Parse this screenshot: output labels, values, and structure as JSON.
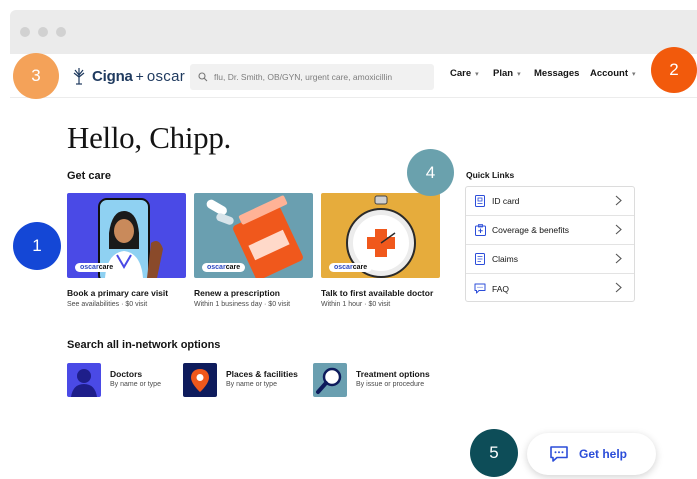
{
  "header": {
    "logo_cigna": "Cigna",
    "logo_plus": "+",
    "logo_oscar": "oscar",
    "search_placeholder": "flu, Dr. Smith, OB/GYN, urgent care, amoxicillin",
    "nav": [
      {
        "label": "Care",
        "has_caret": true
      },
      {
        "label": "Plan",
        "has_caret": true
      },
      {
        "label": "Messages",
        "has_caret": false
      },
      {
        "label": "Account",
        "has_caret": true
      }
    ]
  },
  "greeting": "Hello, Chipp.",
  "get_care": {
    "title": "Get care",
    "badge_text": {
      "oscar": "oscar",
      "care": "care"
    },
    "cards": [
      {
        "title": "Book a primary care visit",
        "subtitle": "See availabilities · $0 visit",
        "bg": "#4a4ae6"
      },
      {
        "title": "Renew a prescription",
        "subtitle": "Within 1 business day · $0 visit",
        "bg": "#6a9fb0"
      },
      {
        "title": "Talk to first available doctor",
        "subtitle": "Within 1 hour · $0 visit",
        "bg": "#e6ac3c"
      }
    ]
  },
  "quick_links": {
    "title": "Quick Links",
    "items": [
      {
        "label": "ID card",
        "icon": "id-card-icon"
      },
      {
        "label": "Coverage & benefits",
        "icon": "coverage-icon"
      },
      {
        "label": "Claims",
        "icon": "claims-icon"
      },
      {
        "label": "FAQ",
        "icon": "chat-icon"
      }
    ]
  },
  "search_options": {
    "title": "Search all in-network options",
    "items": [
      {
        "title": "Doctors",
        "subtitle": "By name or type"
      },
      {
        "title": "Places & facilities",
        "subtitle": "By name or type"
      },
      {
        "title": "Treatment options",
        "subtitle": "By issue or procedure"
      }
    ]
  },
  "help_button": {
    "label": "Get help"
  },
  "markers": [
    "1",
    "2",
    "3",
    "4",
    "5"
  ],
  "colors": {
    "accent_blue": "#2b4dd9",
    "marker_1": "#1447d6",
    "marker_2": "#f25a0c",
    "marker_3": "#f4a259",
    "marker_4": "#6aa1ad",
    "marker_5": "#0d4d58"
  }
}
